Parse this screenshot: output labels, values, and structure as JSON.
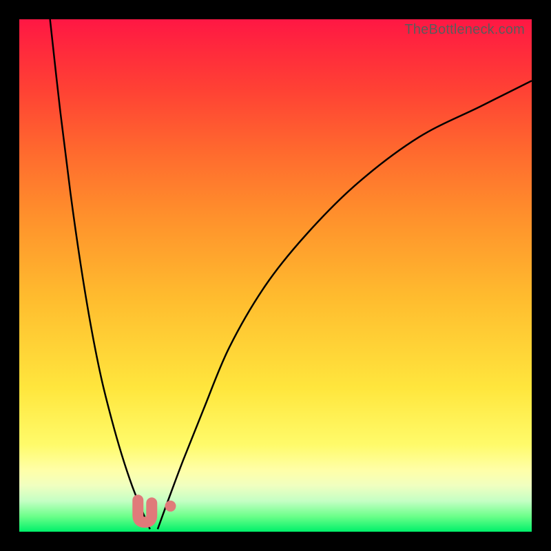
{
  "attribution": "TheBottleneck.com",
  "chart_data": {
    "type": "line",
    "title": "",
    "xlabel": "",
    "ylabel": "",
    "xlim": [
      0,
      100
    ],
    "ylim": [
      0,
      100
    ],
    "series": [
      {
        "name": "left-curve",
        "x": [
          6,
          8,
          10,
          12,
          14,
          16,
          18,
          20,
          22,
          24,
          25.5
        ],
        "values": [
          100,
          82,
          66,
          52,
          40,
          30,
          22,
          15,
          9,
          4,
          0.5
        ]
      },
      {
        "name": "right-curve",
        "x": [
          27,
          29,
          32,
          36,
          41,
          48,
          56,
          66,
          78,
          90,
          100
        ],
        "values": [
          0.5,
          6,
          14,
          24,
          36,
          48,
          58,
          68,
          77,
          83,
          88
        ]
      }
    ],
    "markers": [
      {
        "name": "u-marker",
        "x": 24.5,
        "y": 4
      },
      {
        "name": "dot-marker",
        "x": 29.5,
        "y": 5
      }
    ],
    "background_gradient": {
      "top": "#ff1744",
      "mid": "#ffe63d",
      "bottom": "#00f06a"
    }
  }
}
